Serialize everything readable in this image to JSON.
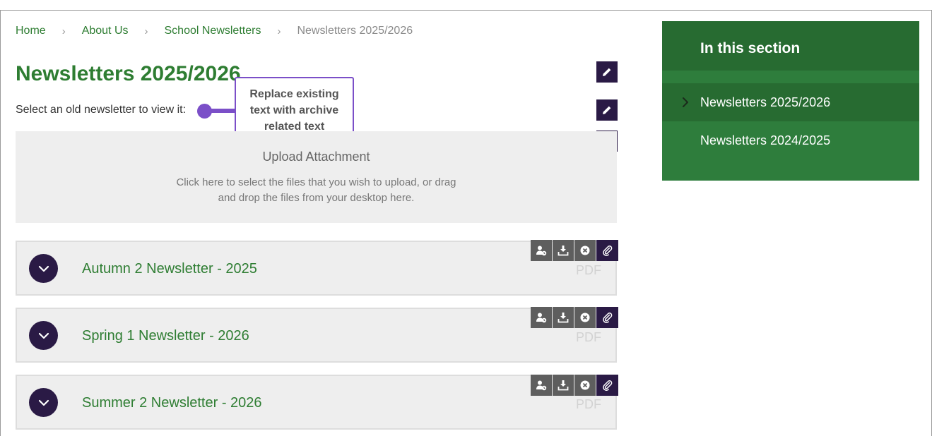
{
  "breadcrumb": [
    "Home",
    "About Us",
    "School Newsletters",
    "Newsletters 2025/2026"
  ],
  "breadcrumb_separator": "›",
  "page": {
    "title": "Newsletters 2025/2026",
    "intro": "Select an old newsletter to view it:"
  },
  "callout": {
    "text": "Replace existing text with archive related text",
    "color": "#7b4fc8"
  },
  "upload": {
    "title": "Upload Attachment",
    "description": "Click here to select the files that you wish to upload, or drag and drop the files from your desktop here."
  },
  "newsletters": [
    {
      "title": "Autumn 2 Newsletter - 2025",
      "type": "PDF"
    },
    {
      "title": "Spring 1 Newsletter - 2026",
      "type": "PDF"
    },
    {
      "title": "Summer 2 Newsletter - 2026",
      "type": "PDF"
    }
  ],
  "row_tools": [
    "user-access-icon",
    "download-icon",
    "remove-icon",
    "attach-icon"
  ],
  "sidebar": {
    "heading": "In this section",
    "items": [
      {
        "label": "Newsletters 2025/2026",
        "active": true
      },
      {
        "label": "Newsletters 2024/2025",
        "active": false
      }
    ]
  },
  "colors": {
    "brand_green": "#2e7d32",
    "sidebar_green": "#2e7d3c",
    "dark_purple": "#2a1a45",
    "accent_purple": "#7b4fc8"
  }
}
